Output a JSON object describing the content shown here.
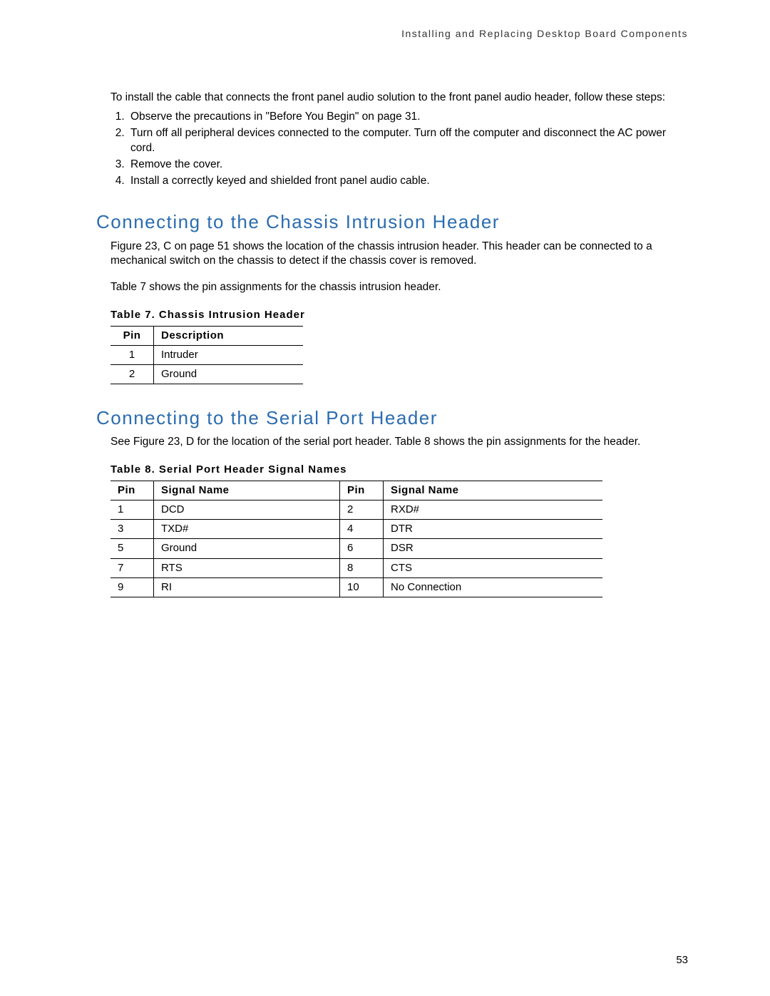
{
  "header_title": "Installing and Replacing Desktop Board Components",
  "page_number": "53",
  "intro": "To install the cable that connects the front panel audio solution to the front panel audio header, follow these steps:",
  "steps": [
    "Observe the precautions in \"Before You Begin\" on page 31.",
    "Turn off all peripheral devices connected to the computer.  Turn off the computer and disconnect the AC power cord.",
    "Remove the cover.",
    "Install a correctly keyed and shielded front panel audio cable."
  ],
  "section1": {
    "title": "Connecting to the Chassis Intrusion Header",
    "p1": "Figure 23, C on page 51 shows the location of the chassis intrusion header.  This header can be connected to a mechanical switch on the chassis to detect if the chassis cover is removed.",
    "p2": "Table 7 shows the pin assignments for the chassis intrusion header.",
    "table_caption": "Table 7.  Chassis Intrusion Header",
    "th_pin": "Pin",
    "th_desc": "Description",
    "rows": [
      {
        "pin": "1",
        "desc": "Intruder"
      },
      {
        "pin": "2",
        "desc": "Ground"
      }
    ]
  },
  "section2": {
    "title": "Connecting to the Serial Port Header",
    "p1": "See Figure 23, D for the location of the serial port header.  Table 8 shows the pin assignments for the header.",
    "table_caption": "Table 8.  Serial Port Header Signal Names",
    "th_pin": "Pin",
    "th_sig": "Signal Name",
    "rows": [
      {
        "p1": "1",
        "s1": "DCD",
        "p2": "2",
        "s2": "RXD#"
      },
      {
        "p1": "3",
        "s1": "TXD#",
        "p2": "4",
        "s2": "DTR"
      },
      {
        "p1": "5",
        "s1": "Ground",
        "p2": "6",
        "s2": "DSR"
      },
      {
        "p1": "7",
        "s1": "RTS",
        "p2": "8",
        "s2": "CTS"
      },
      {
        "p1": "9",
        "s1": "RI",
        "p2": "10",
        "s2": "No Connection"
      }
    ]
  }
}
